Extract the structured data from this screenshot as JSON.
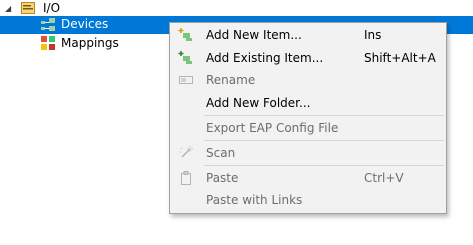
{
  "tree": {
    "root": {
      "label": "I/O"
    },
    "items": [
      {
        "label": "Devices"
      },
      {
        "label": "Mappings"
      }
    ]
  },
  "context_menu": {
    "items": [
      {
        "label": "Add New Item...",
        "shortcut": "Ins",
        "icon": "add-new-item-icon",
        "enabled": true
      },
      {
        "label": "Add Existing Item...",
        "shortcut": "Shift+Alt+A",
        "icon": "add-existing-item-icon",
        "enabled": true
      },
      {
        "label": "Rename",
        "shortcut": "",
        "icon": "rename-icon",
        "enabled": false
      },
      {
        "label": "Add New Folder...",
        "shortcut": "",
        "icon": "",
        "enabled": true
      },
      {
        "label": "Export EAP Config File",
        "shortcut": "",
        "icon": "",
        "enabled": false
      },
      {
        "label": "Scan",
        "shortcut": "",
        "icon": "scan-wand-icon",
        "enabled": false
      },
      {
        "label": "Paste",
        "shortcut": "Ctrl+V",
        "icon": "paste-icon",
        "enabled": false
      },
      {
        "label": "Paste with Links",
        "shortcut": "",
        "icon": "",
        "enabled": false
      }
    ]
  },
  "colors": {
    "selection": "#0078d7",
    "menu_background": "#f2f2f2",
    "disabled_text": "#6d6d6d"
  }
}
